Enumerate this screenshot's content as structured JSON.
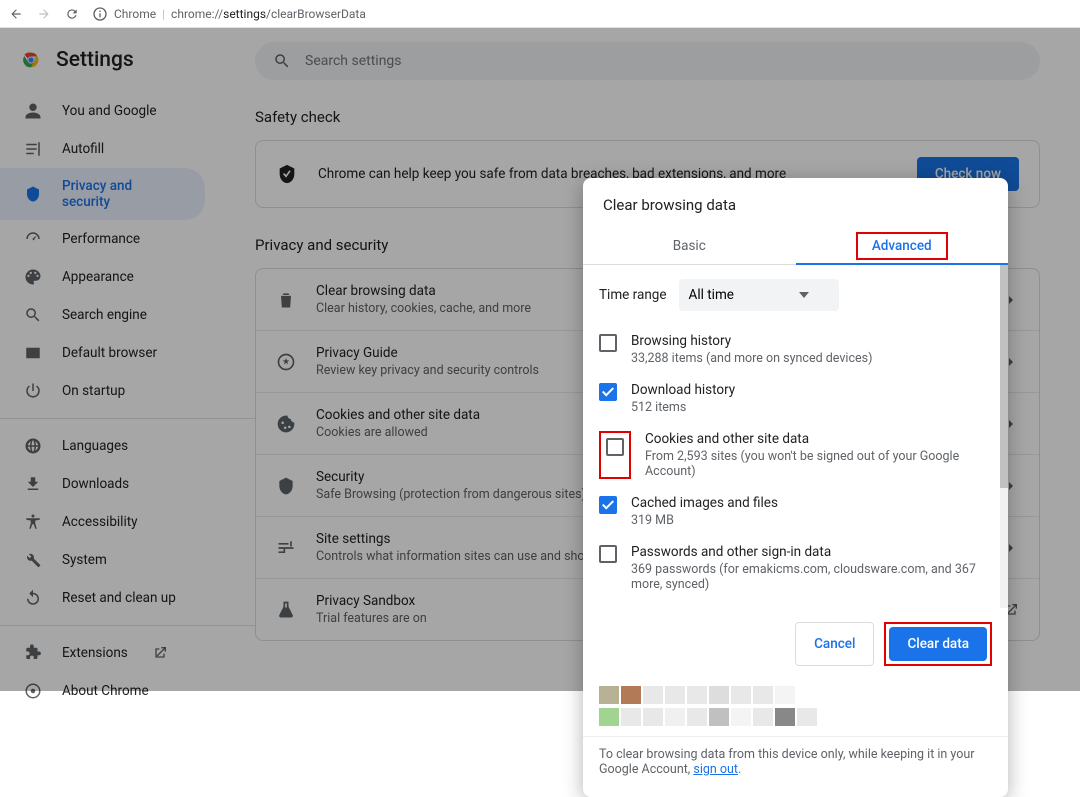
{
  "toolbar": {
    "product": "Chrome",
    "url_prefix": "chrome://",
    "url_mid": "settings",
    "url_suffix": "/clearBrowserData"
  },
  "header": {
    "title": "Settings"
  },
  "search": {
    "placeholder": "Search settings"
  },
  "sidebar": {
    "items": [
      {
        "label": "You and Google",
        "icon": "person"
      },
      {
        "label": "Autofill",
        "icon": "autofill"
      },
      {
        "label": "Privacy and security",
        "icon": "shield",
        "active": true
      },
      {
        "label": "Performance",
        "icon": "speed"
      },
      {
        "label": "Appearance",
        "icon": "palette"
      },
      {
        "label": "Search engine",
        "icon": "search"
      },
      {
        "label": "Default browser",
        "icon": "browser"
      },
      {
        "label": "On startup",
        "icon": "power"
      }
    ],
    "adv": [
      {
        "label": "Languages",
        "icon": "globe"
      },
      {
        "label": "Downloads",
        "icon": "download"
      },
      {
        "label": "Accessibility",
        "icon": "accessibility"
      },
      {
        "label": "System",
        "icon": "wrench"
      },
      {
        "label": "Reset and clean up",
        "icon": "restore"
      }
    ],
    "footer": [
      {
        "label": "Extensions",
        "icon": "extension",
        "external": true
      },
      {
        "label": "About Chrome",
        "icon": "chrome"
      }
    ]
  },
  "safety": {
    "title": "Safety check",
    "msg": "Chrome can help keep you safe from data breaches, bad extensions, and more",
    "btn": "Check now"
  },
  "ps": {
    "title": "Privacy and security",
    "rows": [
      {
        "title": "Clear browsing data",
        "sub": "Clear history, cookies, cache, and more",
        "icon": "trash"
      },
      {
        "title": "Privacy Guide",
        "sub": "Review key privacy and security controls",
        "icon": "guide"
      },
      {
        "title": "Cookies and other site data",
        "sub": "Cookies are allowed",
        "icon": "cookie"
      },
      {
        "title": "Security",
        "sub": "Safe Browsing (protection from dangerous sites) and other security settings",
        "icon": "security"
      },
      {
        "title": "Site settings",
        "sub": "Controls what information sites can use and show",
        "icon": "tune"
      },
      {
        "title": "Privacy Sandbox",
        "sub": "Trial features are on",
        "icon": "flask",
        "external": true
      }
    ]
  },
  "dialog": {
    "title": "Clear browsing data",
    "tabs": {
      "basic": "Basic",
      "advanced": "Advanced"
    },
    "time_label": "Time range",
    "time_value": "All time",
    "items": [
      {
        "title": "Browsing history",
        "sub": "33,288 items (and more on synced devices)",
        "checked": false
      },
      {
        "title": "Download history",
        "sub": "512 items",
        "checked": true
      },
      {
        "title": "Cookies and other site data",
        "sub": "From 2,593 sites (you won't be signed out of your Google Account)",
        "checked": false,
        "highlight": true
      },
      {
        "title": "Cached images and files",
        "sub": "319 MB",
        "checked": true
      },
      {
        "title": "Passwords and other sign-in data",
        "sub": "369 passwords (for emakicms.com, cloudsware.com, and 367 more, synced)",
        "checked": false
      }
    ],
    "cancel": "Cancel",
    "clear": "Clear data",
    "footer_pre": "To clear browsing data from this device only, while keeping it in your Google Account, ",
    "footer_link": "sign out",
    "footer_post": "."
  }
}
